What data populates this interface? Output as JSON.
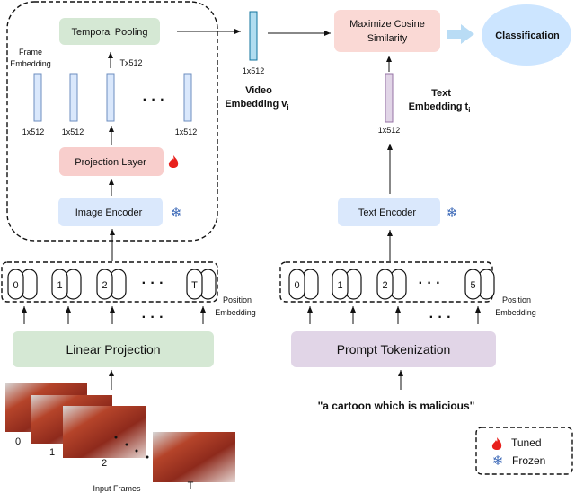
{
  "video_branch": {
    "temporal_pooling": "Temporal Pooling",
    "frame_embedding_line1": "Frame",
    "frame_embedding_line2": "Embedding",
    "pooling_input_dim": "Tx512",
    "frame_dims": [
      "1x512",
      "1x512",
      "1x512"
    ],
    "projection_layer": "Projection Layer",
    "image_encoder": "Image Encoder",
    "video_embedding_dim": "1x512",
    "video_embedding_line1": "Video",
    "video_embedding_line2": "Embedding v",
    "video_embedding_sub": "i",
    "tokens": [
      "0",
      "1",
      "2",
      "T"
    ],
    "position_embedding_line1": "Position",
    "position_embedding_line2": "Embedding",
    "linear_projection": "Linear Projection",
    "frame_labels": [
      "0",
      "1",
      "2",
      "T"
    ],
    "input_frames": "Input Frames"
  },
  "text_branch": {
    "maximize_line1": "Maximize Cosine",
    "maximize_line2": "Similarity",
    "classification": "Classification",
    "text_embedding_dim": "1x512",
    "text_embedding_line1": "Text",
    "text_embedding_line2": "Embedding t",
    "text_embedding_sub": "i",
    "text_encoder": "Text Encoder",
    "tokens": [
      "0",
      "1",
      "2",
      "5"
    ],
    "position_embedding_line1": "Position",
    "position_embedding_line2": "Embedding",
    "prompt_tokenization": "Prompt Tokenization",
    "prompt": "\"a cartoon which is malicious\""
  },
  "legend": {
    "tuned": "Tuned",
    "frozen": "Frozen",
    "tuned_icon": "fire-icon",
    "frozen_icon": "snowflake-icon"
  },
  "colors": {
    "green_box": "#d5e8d4",
    "red_box": "#f8cecc",
    "blue_box": "#dae8fc",
    "purple_box": "#e1d5e7",
    "classification": "#cce5ff"
  }
}
